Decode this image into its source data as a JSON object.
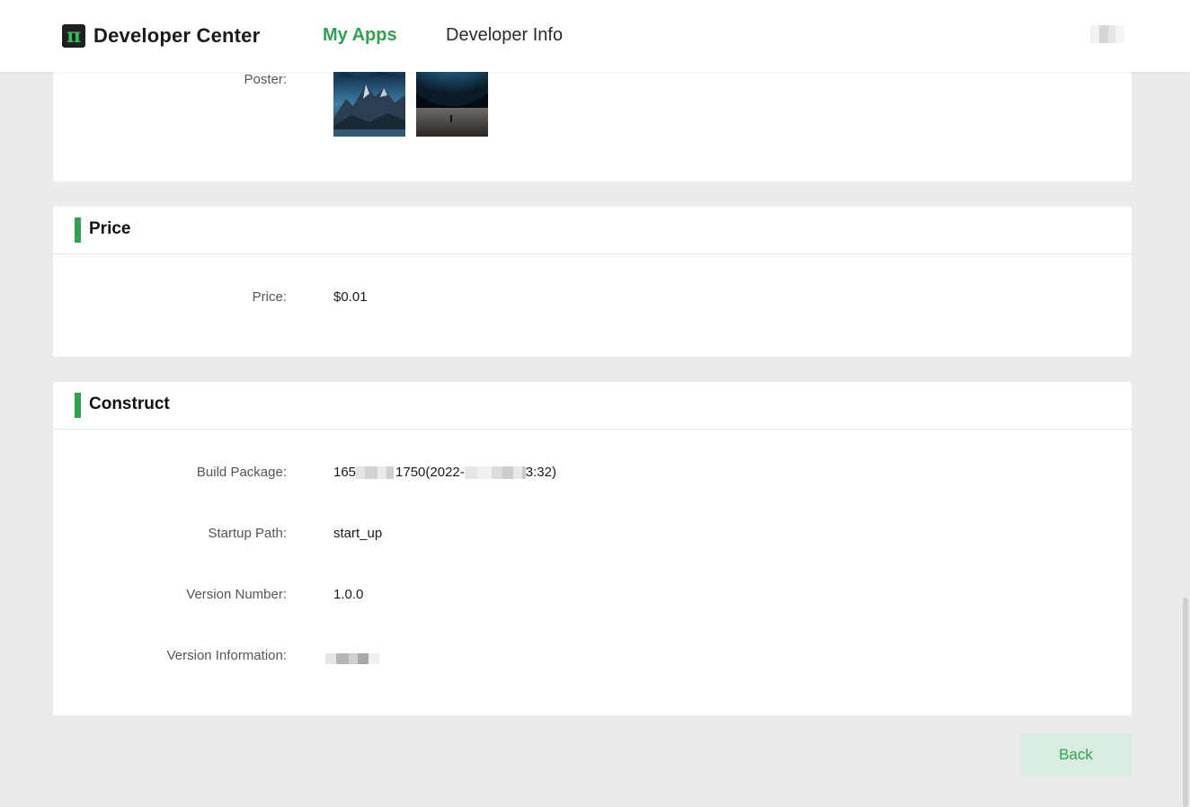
{
  "header": {
    "logo_glyph": "π",
    "brand": "Developer Center",
    "nav": [
      {
        "label": "My Apps",
        "active": true
      },
      {
        "label": "Developer Info",
        "active": false
      }
    ]
  },
  "poster_section": {
    "label": "Poster:",
    "images": [
      "mountains-poster",
      "planet-poster"
    ]
  },
  "price_section": {
    "title": "Price",
    "fields": [
      {
        "label": "Price:",
        "value": "$0.01"
      }
    ]
  },
  "construct_section": {
    "title": "Construct",
    "fields": [
      {
        "label": "Build Package:",
        "value_prefix": "165",
        "value_middle": "1750(2022-",
        "value_suffix": "3:32)"
      },
      {
        "label": "Startup Path:",
        "value": "start_up"
      },
      {
        "label": "Version Number:",
        "value": "1.0.0"
      },
      {
        "label": "Version Information:",
        "value": ""
      }
    ]
  },
  "actions": {
    "back_label": "Back"
  },
  "colors": {
    "accent": "#2ea24c",
    "background": "#ebebeb",
    "back_button_bg": "#d9ece0"
  }
}
